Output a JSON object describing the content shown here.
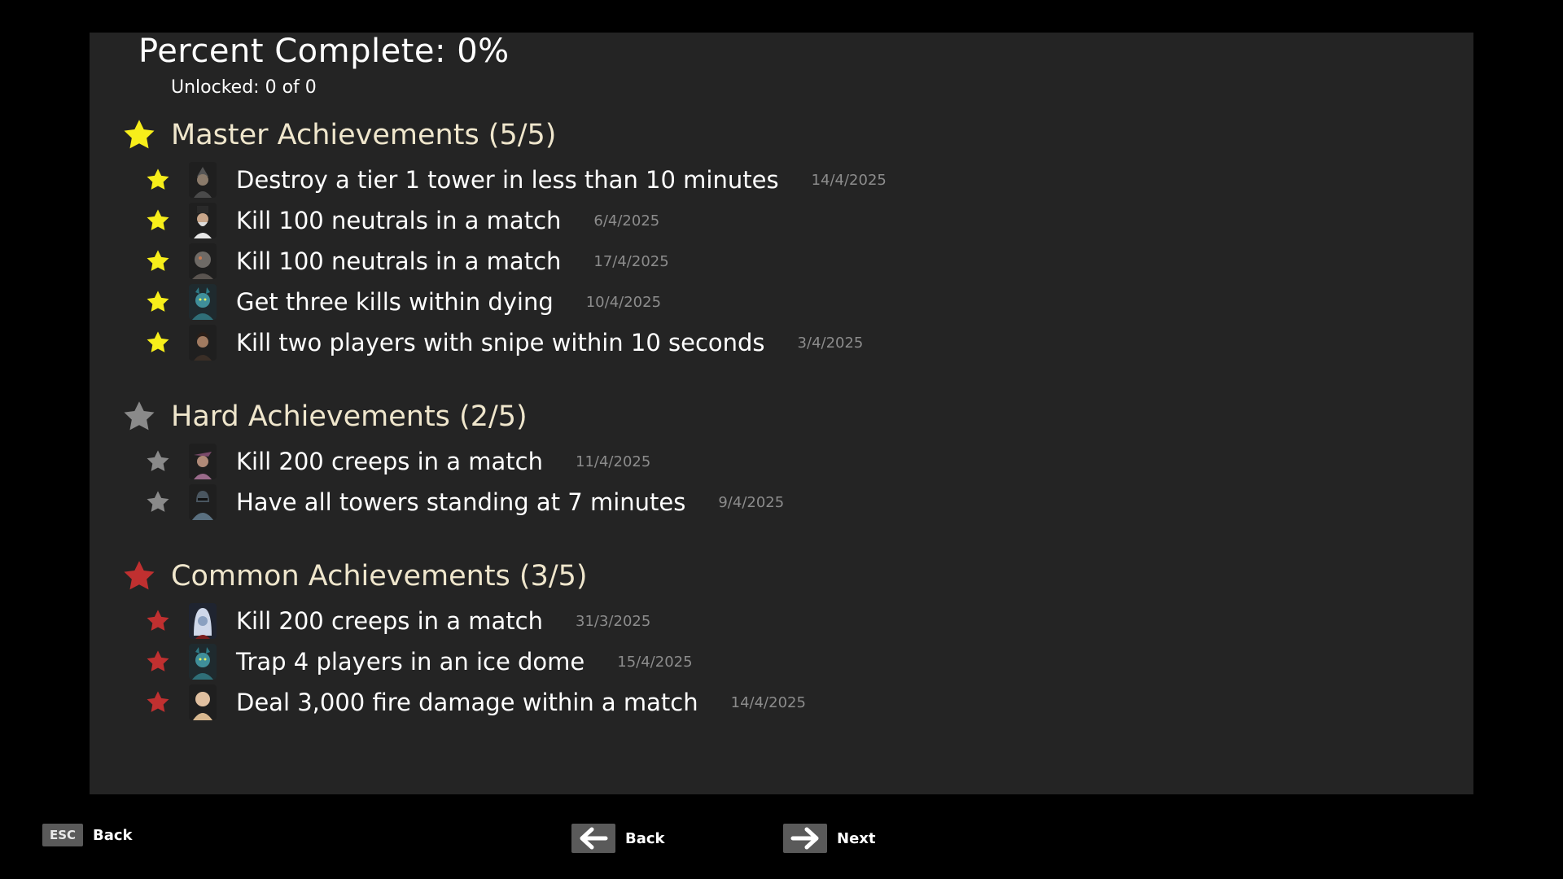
{
  "summary": {
    "percent_complete": "Percent Complete: 0%",
    "unlocked": "Unlocked: 0 of 0"
  },
  "colors": {
    "master_star": "#f7ee1a",
    "hard_star": "#8a8a8a",
    "common_star": "#c03030",
    "section_title": "#efe6cc",
    "date_text": "#8c8c8c"
  },
  "sections": [
    {
      "title": "Master Achievements (5/5)",
      "star_icon": "gold-star-icon",
      "items": [
        {
          "text": "Destroy a tier 1 tower in less than 10 minutes",
          "date": "14/4/2025",
          "portrait": "hooded-rogue-portrait"
        },
        {
          "text": "Kill 100 neutrals in a match",
          "date": "6/4/2025",
          "portrait": "bearded-tophat-portrait"
        },
        {
          "text": "Kill 100 neutrals in a match",
          "date": "17/4/2025",
          "portrait": "armored-beast-portrait"
        },
        {
          "text": "Get three kills within dying",
          "date": "10/4/2025",
          "portrait": "blue-demon-portrait"
        },
        {
          "text": "Kill two players with snipe within 10 seconds",
          "date": "3/4/2025",
          "portrait": "dark-haired-warrior-portrait"
        }
      ]
    },
    {
      "title": "Hard Achievements (2/5)",
      "star_icon": "gray-star-icon",
      "items": [
        {
          "text": "Kill 200 creeps in a match",
          "date": "11/4/2025",
          "portrait": "feathered-hat-portrait"
        },
        {
          "text": "Have all towers standing at 7 minutes",
          "date": "9/4/2025",
          "portrait": "helmeted-knight-portrait"
        }
      ]
    },
    {
      "title": "Common Achievements (3/5)",
      "star_icon": "red-star-icon",
      "items": [
        {
          "text": "Kill 200 creeps in a match",
          "date": "31/3/2025",
          "portrait": "white-haired-elf-portrait"
        },
        {
          "text": "Trap 4 players in an ice dome",
          "date": "15/4/2025",
          "portrait": "blue-demon-portrait"
        },
        {
          "text": "Deal 3,000 fire damage within a match",
          "date": "14/4/2025",
          "portrait": "bald-monk-portrait"
        }
      ]
    }
  ],
  "footer": {
    "esc_key": "ESC",
    "esc_label": "Back",
    "prev_label": "Back",
    "next_label": "Next"
  }
}
